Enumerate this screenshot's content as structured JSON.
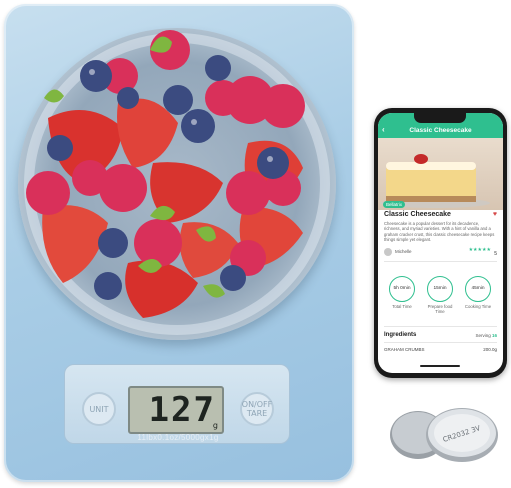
{
  "scale": {
    "display_value": "127",
    "display_unit": "g",
    "left_button": "UNIT",
    "right_button": "ON/OFF TARE",
    "spec_text": "11lbx0.1oz/5000gx1g"
  },
  "phone": {
    "app_title": "Classic Cheesecake",
    "badge": "Bellatrix",
    "recipe_title": "Classic Cheesecake",
    "recipe_description": "Cheesecake is a popular dessert for its decadence, richness, and myriad varieties. With a hint of vanilla and a graham cracker crust, this classic cheesecake recipe keeps things simple yet elegant.",
    "author": "Michelle",
    "rating": "5",
    "times": [
      {
        "value": "5h 0min",
        "label": "Total Time"
      },
      {
        "value": "15min",
        "label": "Prepare food Time"
      },
      {
        "value": "45min",
        "label": "Cooking Time"
      }
    ],
    "ingredients_header": "Ingredients",
    "serving_label": "Serving",
    "serving_count": "16",
    "ingredients": [
      {
        "name": "GRAHAM CRUMBS",
        "qty": "200.0g"
      }
    ]
  },
  "batteries": {
    "label": "CR2032 3V"
  }
}
